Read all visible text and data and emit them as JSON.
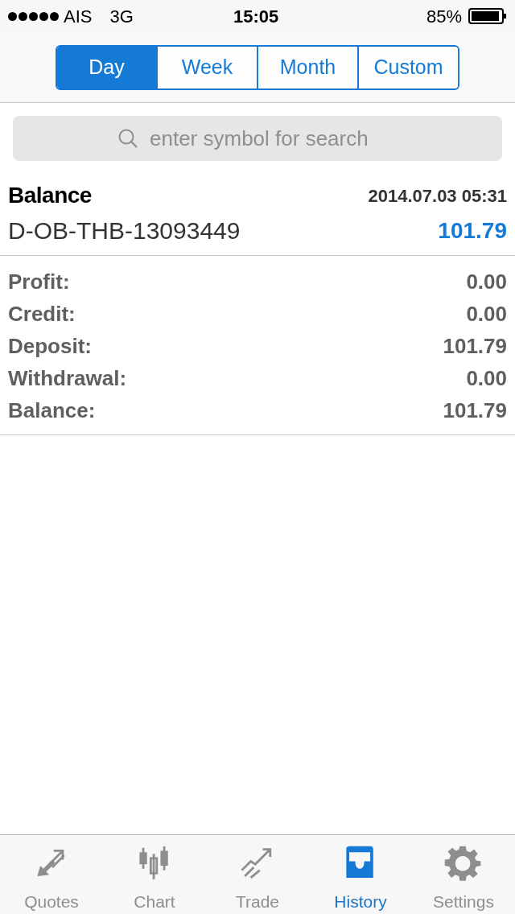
{
  "status_bar": {
    "carrier": "AIS",
    "network": "3G",
    "time": "15:05",
    "battery": "85%"
  },
  "periods": [
    {
      "label": "Day",
      "selected": true
    },
    {
      "label": "Week",
      "selected": false
    },
    {
      "label": "Month",
      "selected": false
    },
    {
      "label": "Custom",
      "selected": false
    }
  ],
  "search": {
    "placeholder": "enter symbol for search"
  },
  "entry": {
    "type": "Balance",
    "date": "2014.07.03 05:31",
    "comment": "D-OB-THB-13093449",
    "amount": "101.79"
  },
  "summary": [
    {
      "label": "Profit:",
      "value": "0.00"
    },
    {
      "label": "Credit:",
      "value": "0.00"
    },
    {
      "label": "Deposit:",
      "value": "101.79"
    },
    {
      "label": "Withdrawal:",
      "value": "0.00"
    },
    {
      "label": "Balance:",
      "value": "101.79"
    }
  ],
  "tab_bar": [
    {
      "label": "Quotes",
      "selected": false
    },
    {
      "label": "Chart",
      "selected": false
    },
    {
      "label": "Trade",
      "selected": false
    },
    {
      "label": "History",
      "selected": true
    },
    {
      "label": "Settings",
      "selected": false
    }
  ]
}
